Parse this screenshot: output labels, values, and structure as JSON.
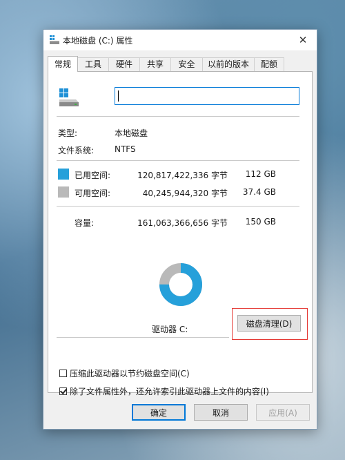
{
  "window": {
    "title": "本地磁盘 (C:) 属性",
    "close_glyph": "✕"
  },
  "tabs": [
    {
      "label": "常规",
      "active": true
    },
    {
      "label": "工具",
      "active": false
    },
    {
      "label": "硬件",
      "active": false
    },
    {
      "label": "共享",
      "active": false
    },
    {
      "label": "安全",
      "active": false
    },
    {
      "label": "以前的版本",
      "active": false
    },
    {
      "label": "配额",
      "active": false
    }
  ],
  "general": {
    "name_value": "",
    "type_label": "类型:",
    "type_value": "本地磁盘",
    "fs_label": "文件系统:",
    "fs_value": "NTFS",
    "used": {
      "label": "已用空间:",
      "bytes": "120,817,422,336 字节",
      "size": "112 GB",
      "color": "#26a0da"
    },
    "free": {
      "label": "可用空间:",
      "bytes": "40,245,944,320 字节",
      "size": "37.4 GB",
      "color": "#b9b9b9"
    },
    "capacity": {
      "label": "容量:",
      "bytes": "161,063,366,656 字节",
      "size": "150 GB"
    },
    "usage_fraction": 0.75,
    "drive_label": "驱动器 C:",
    "cleanup_button": "磁盘清理(D)",
    "compress_option": {
      "label": "压缩此驱动器以节约磁盘空间(C)",
      "checked": false
    },
    "index_option": {
      "label": "除了文件属性外，还允许索引此驱动器上文件的内容(I)",
      "checked": true
    }
  },
  "buttons": {
    "ok": "确定",
    "cancel": "取消",
    "apply": "应用(A)"
  },
  "colors": {
    "accent": "#0078d7",
    "highlight": "#e53935"
  }
}
